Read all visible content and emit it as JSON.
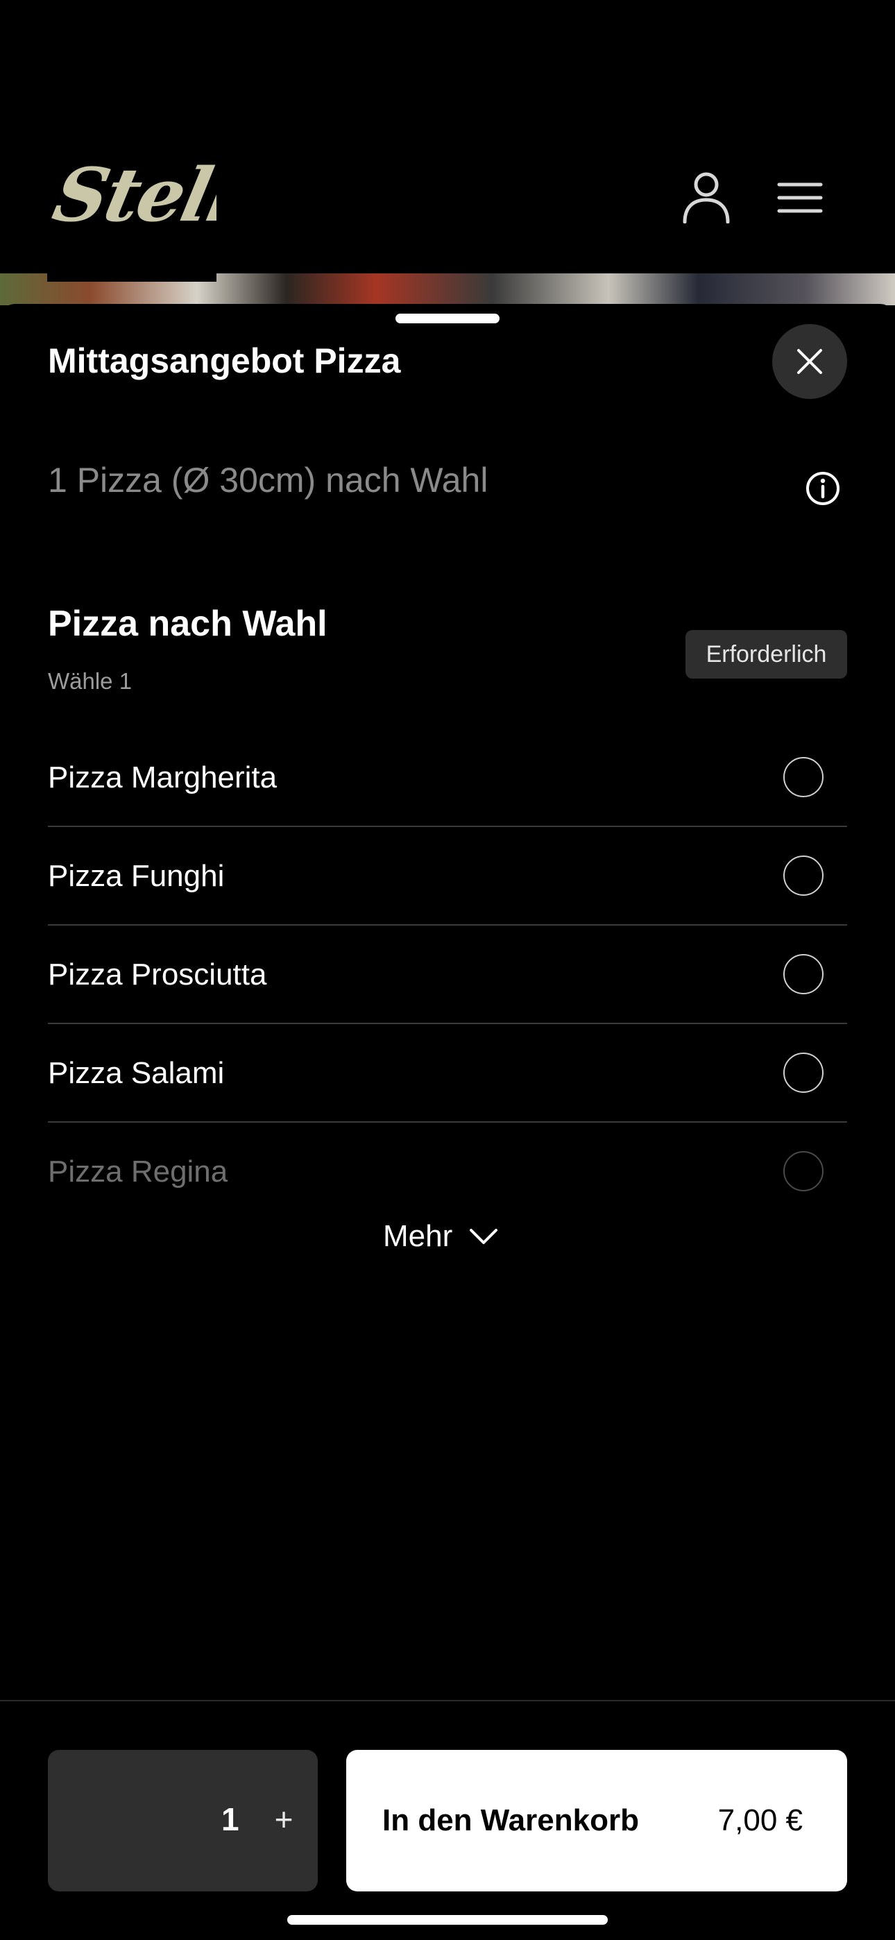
{
  "header": {
    "logo_text": "Stella",
    "user_icon": "user-icon",
    "menu_icon": "hamburger-menu-icon"
  },
  "sheet": {
    "title": "Mittagsangebot Pizza",
    "close_icon": "close-icon",
    "description": "1 Pizza (Ø 30cm) nach Wahl",
    "info_icon": "info-icon"
  },
  "group": {
    "title": "Pizza nach Wahl",
    "subtitle": "Wähle 1",
    "badge": "Erforderlich",
    "options": [
      {
        "label": "Pizza Margherita"
      },
      {
        "label": "Pizza Funghi"
      },
      {
        "label": "Pizza Prosciutta"
      },
      {
        "label": "Pizza Salami"
      },
      {
        "label": "Pizza Regina"
      }
    ],
    "more_label": "Mehr"
  },
  "footer": {
    "quantity": "1",
    "plus_label": "+",
    "cart_label": "In den Warenkorb",
    "price": "7,00 €"
  },
  "colors": {
    "background": "#000000",
    "logo": "#c9c7a8",
    "surface": "#2f2f2f",
    "cart_button": "#ffffff"
  }
}
